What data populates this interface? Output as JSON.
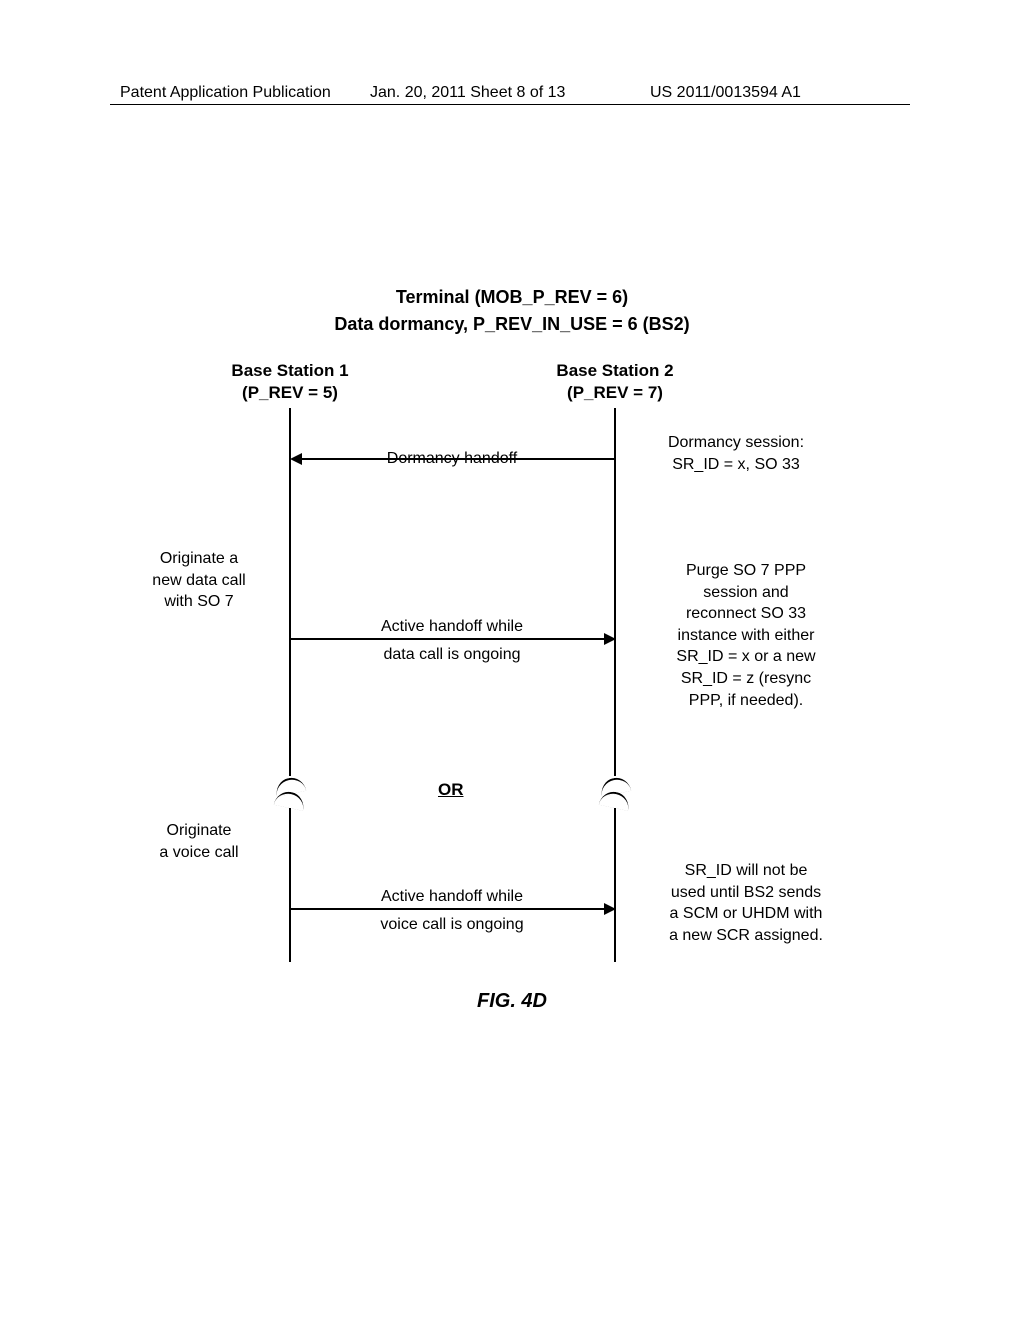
{
  "header": {
    "left": "Patent Application Publication",
    "center": "Jan. 20, 2011  Sheet 8 of 13",
    "right": "US 2011/0013594 A1"
  },
  "title": {
    "line1": "Terminal (MOB_P_REV = 6)",
    "line2": "Data dormancy, P_REV_IN_USE = 6 (BS2)"
  },
  "bs1": {
    "name": "Base Station 1",
    "rev": "(P_REV = 5)"
  },
  "bs2": {
    "name": "Base Station 2",
    "rev": "(P_REV = 7)"
  },
  "msg1": {
    "label": "Dormancy handoff"
  },
  "note_right_1": "Dormancy session:\nSR_ID = x, SO 33",
  "note_left_1": "Originate a\nnew data call\nwith SO 7",
  "msg2": {
    "l1": "Active handoff while",
    "l2": "data call is ongoing"
  },
  "note_right_2": "Purge SO 7 PPP\nsession and\nreconnect SO 33\ninstance with either\nSR_ID = x or a new\nSR_ID = z (resync\nPPP, if needed).",
  "or": "OR",
  "note_left_2": "Originate\na voice call",
  "msg3": {
    "l1": "Active handoff while",
    "l2": "voice call is ongoing"
  },
  "note_right_3": "SR_ID will not be\nused until BS2 sends\na SCM or UHDM with\na new SCR assigned.",
  "figure": "FIG. 4D"
}
